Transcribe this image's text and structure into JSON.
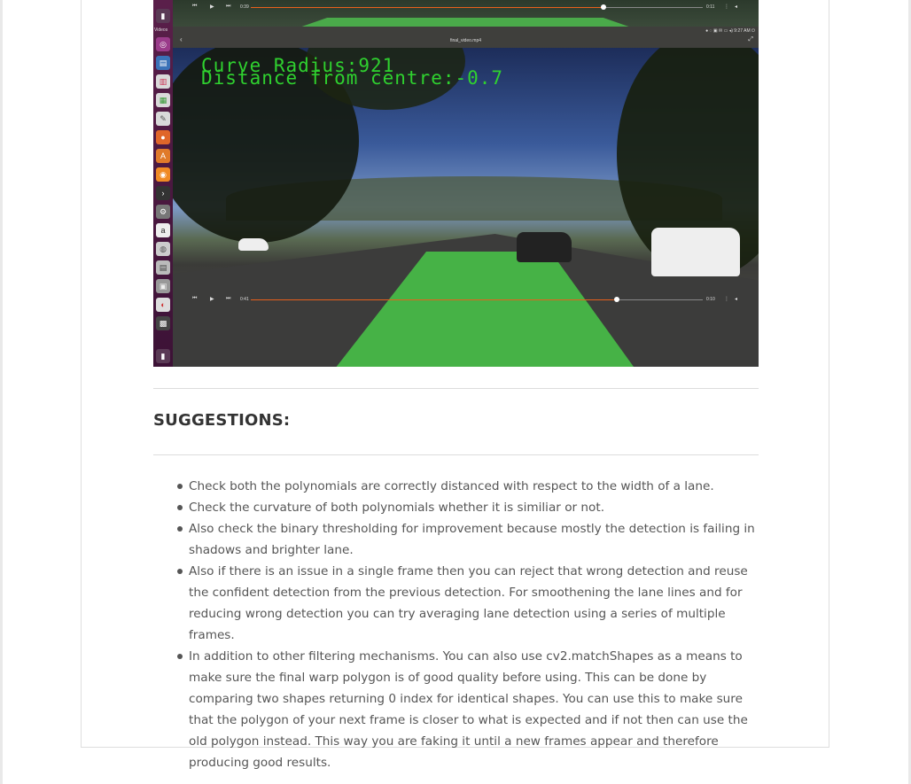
{
  "screenshot": {
    "launcher_label": "Videos",
    "top_player": {
      "elapsed": "0:39",
      "remaining": "0:11",
      "progress": 0.78
    },
    "window_title": "final_video.mp4",
    "tray_time": "9:27 AM",
    "overlay": {
      "curve_radius": "Curve Radius:921",
      "distance": "Distance from centre:-0.7"
    },
    "bottom_player": {
      "elapsed": "0:41",
      "remaining": "0:10",
      "progress": 0.81
    },
    "launcher_icons": [
      "trash-icon",
      "ubuntu-logo-icon",
      "files-icon",
      "writer-icon",
      "calc-icon",
      "impress-icon",
      "text-editor-icon",
      "firefox-icon",
      "software-center-icon",
      "blender-icon",
      "terminal-icon",
      "settings-icon",
      "amazon-icon",
      "disc-icon",
      "app-icon",
      "app-icon",
      "app-icon",
      "app-icon",
      "clapper-icon",
      "trash-icon"
    ]
  },
  "section": {
    "heading": "SUGGESTIONS:",
    "items": [
      "Check both the polynomials are correctly distanced with respect to the width of a lane.",
      "Check the curvature of both polynomials whether it is similiar or not.",
      "Also check the binary thresholding for improvement because mostly the detection is failing in shadows and brighter lane.",
      "Also if there is an issue in a single frame then you can reject that wrong detection and reuse the confident detection from the previous detection. For smoothening the lane lines and for reducing wrong detection you can try averaging lane detection using a series of multiple frames.",
      "In addition to other filtering mechanisms. You can also use cv2.matchShapes as a means to make sure the final warp polygon is of good quality before using. This can be done by comparing two shapes returning 0 index for identical shapes. You can use this to make sure that the polygon of your next frame is closer to what is expected and if not then can use the old polygon instead. This way you are faking it until a new frames appear and therefore producing good results."
    ]
  }
}
